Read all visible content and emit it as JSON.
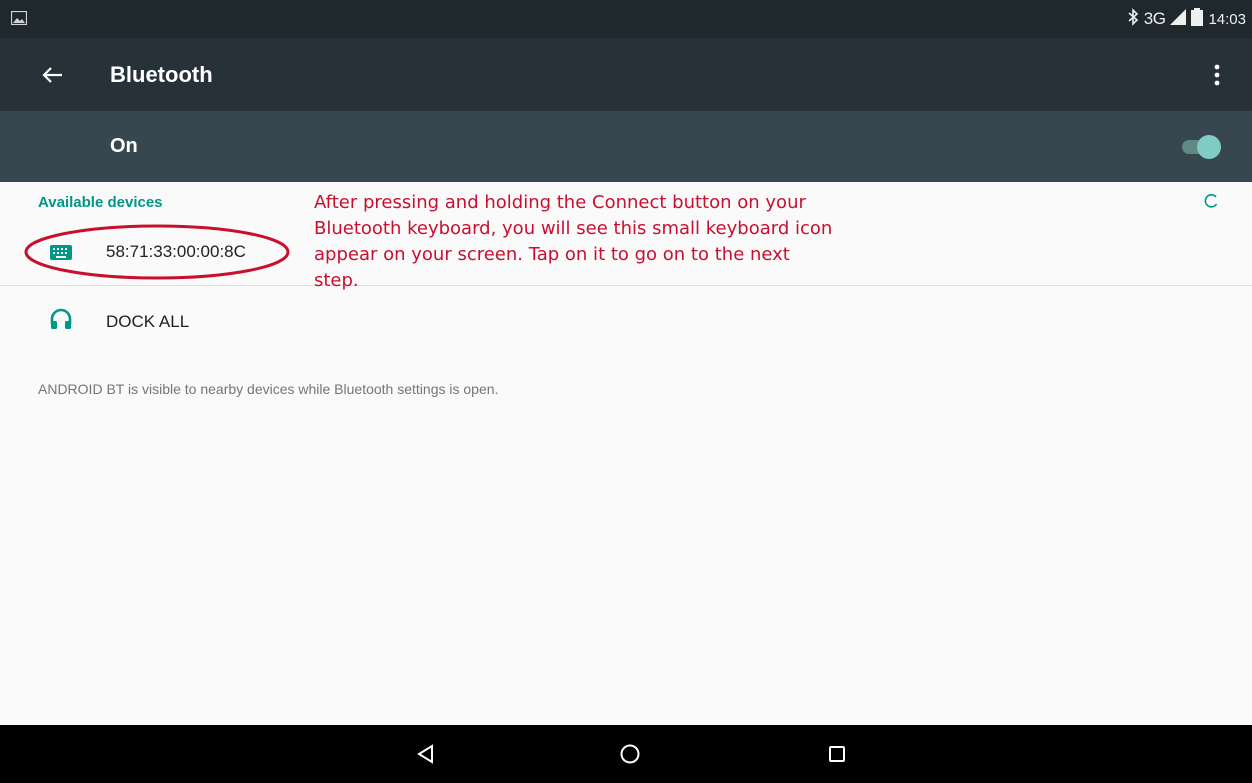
{
  "status_bar": {
    "left_icon": "screenshot-notification-icon",
    "bluetooth_icon": "bluetooth-icon",
    "network_type": "3G",
    "signal_icon": "cell-signal-icon",
    "battery_icon": "battery-icon",
    "time": "14:03"
  },
  "toolbar": {
    "back_icon": "arrow-back-icon",
    "title": "Bluetooth",
    "overflow_icon": "more-vert-icon"
  },
  "master_switch": {
    "label": "On",
    "enabled": true,
    "accent_color": "#80cbc4"
  },
  "available_devices": {
    "header": "Available devices",
    "scanning_icon": "progress-spinner-icon",
    "devices": [
      {
        "name": "58:71:33:00:00:8C",
        "icon": "keyboard-icon"
      },
      {
        "name": "DOCK ALL",
        "icon": "headset-icon"
      }
    ]
  },
  "visibility_note": "ANDROID BT is visible to nearby devices while Bluetooth settings is open.",
  "annotation": {
    "text": "After pressing and holding the Connect button on your Bluetooth keyboard, you will see this small keyboard icon appear on your screen. Tap on it to go on to the next step.",
    "color": "#c8102e"
  },
  "nav_bar": {
    "back_icon": "nav-back-icon",
    "home_icon": "nav-home-icon",
    "recents_icon": "nav-recents-icon"
  },
  "colors": {
    "status_bar": "#1f282c",
    "toolbar": "#263238",
    "switch_bar": "#37474f",
    "accent": "#009688"
  }
}
